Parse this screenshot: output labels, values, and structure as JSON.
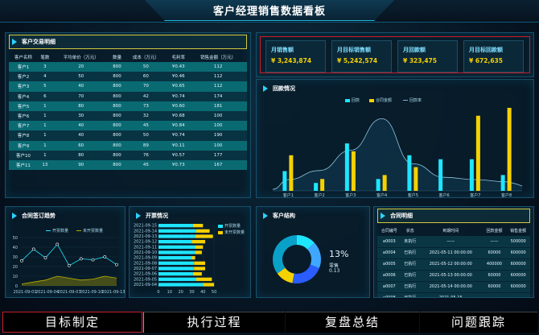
{
  "header": {
    "title": "客户经理销售数据看板"
  },
  "customer_table": {
    "title": "客户交易明细",
    "columns": [
      "客户名称",
      "笔数",
      "平均单价（万元）",
      "数量",
      "成本（万元）",
      "毛利率",
      "销售金额（万元）"
    ],
    "rows": [
      [
        "客户1",
        "3",
        "20",
        "800",
        "50",
        "¥0.43",
        "112"
      ],
      [
        "客户2",
        "4",
        "50",
        "800",
        "60",
        "¥0.46",
        "112"
      ],
      [
        "客户3",
        "5",
        "40",
        "800",
        "70",
        "¥0.65",
        "112"
      ],
      [
        "客户4",
        "6",
        "70",
        "800",
        "42",
        "¥0.74",
        "174"
      ],
      [
        "客户5",
        "1",
        "80",
        "800",
        "73",
        "¥0.60",
        "181"
      ],
      [
        "客户6",
        "1",
        "30",
        "800",
        "32",
        "¥0.68",
        "100"
      ],
      [
        "客户7",
        "1",
        "40",
        "800",
        "45",
        "¥0.84",
        "100"
      ],
      [
        "客户8",
        "1",
        "40",
        "800",
        "50",
        "¥0.74",
        "190"
      ],
      [
        "客户9",
        "1",
        "60",
        "800",
        "89",
        "¥0.11",
        "100"
      ],
      [
        "客户10",
        "1",
        "80",
        "800",
        "76",
        "¥0.57",
        "177"
      ],
      [
        "客户11",
        "13",
        "90",
        "800",
        "45",
        "¥0.73",
        "167"
      ]
    ]
  },
  "kpis": [
    {
      "label": "月销售额",
      "value": "¥ 3,243,874"
    },
    {
      "label": "月目标销售额",
      "value": "¥ 5,242,574"
    },
    {
      "label": "月回款额",
      "value": "¥ 323,475"
    },
    {
      "label": "月目标回款额",
      "value": "¥ 672,635"
    }
  ],
  "payment_panel": {
    "title": "回款情况"
  },
  "contract_panel": {
    "title": "合同签订趋势"
  },
  "invoice_panel": {
    "title": "开票情况"
  },
  "structure_panel": {
    "title": "客户结构",
    "percent": "13%",
    "sub_label": "零售",
    "sub_value": "0.13"
  },
  "contract_detail": {
    "title": "合同明细",
    "columns": [
      "合同编号",
      "状态",
      "到期时间",
      "回款金额",
      "销售金额"
    ],
    "rows": [
      [
        "a0003",
        "未执行",
        "——",
        "——",
        "500000"
      ],
      [
        "a0004",
        "已执行",
        "2021-05-11 00:00:00",
        "60000",
        "600000"
      ],
      [
        "a0005",
        "已执行",
        "2021-05-12 00:00:00",
        "400000",
        "600000"
      ],
      [
        "a0006",
        "已执行",
        "2021-05-13 00:00:00",
        "60000",
        "600000"
      ],
      [
        "a0007",
        "已执行",
        "2021-05-14 00:00:00",
        "60000",
        "600000"
      ],
      [
        "a0008",
        "已执行",
        "2021-05-15",
        "",
        ""
      ]
    ]
  },
  "bottom_tabs": [
    "目标制定",
    "执行过程",
    "复盘总结",
    "问题跟踪"
  ],
  "colors": {
    "accent": "#2bd3ff",
    "cyan": "#1ee6ff",
    "yellow": "#f5d100",
    "tab_active_border": "#d22"
  },
  "chart_data": [
    {
      "type": "bar",
      "title": "回款情况",
      "categories": [
        "客户1",
        "客户2",
        "客户3",
        "客户4",
        "客户5",
        "客户6",
        "客户7",
        "客户8"
      ],
      "series": [
        {
          "name": "回款",
          "values": [
            5,
            2,
            12,
            3,
            9,
            8,
            8,
            4
          ]
        },
        {
          "name": "合同金额",
          "values": [
            9,
            3,
            10,
            4,
            6,
            0,
            19,
            21
          ]
        },
        {
          "name": "回款率",
          "values": [
            0.5,
            0.9,
            1.8,
            3.2,
            1.2,
            0.6,
            0.5,
            0.4
          ]
        }
      ],
      "ylim": [
        0,
        22
      ]
    },
    {
      "type": "line",
      "title": "合同签订趋势",
      "x": [
        "2021-09-01",
        "2021-09-04",
        "2021-09-07",
        "2021-09-10",
        "2021-09-13"
      ],
      "series": [
        {
          "name": "开票数量",
          "values": [
            26,
            38,
            29,
            43,
            21,
            28,
            27,
            30,
            22
          ]
        },
        {
          "name": "未开票数量",
          "values": [
            2,
            4,
            6,
            10,
            8,
            6,
            7,
            10,
            8
          ]
        }
      ],
      "yticks": [
        "50",
        "40",
        "30",
        "20",
        "10",
        "0"
      ],
      "ylim": [
        0,
        50
      ]
    },
    {
      "type": "bar",
      "title": "开票情况",
      "categories": [
        "2021-09-15",
        "2021-09-14",
        "2021-09-13",
        "2021-09-12",
        "2021-09-11",
        "2021-09-10",
        "2021-09-09",
        "2021-09-08",
        "2021-09-07",
        "2021-09-06",
        "2021-09-05",
        "2021-09-04"
      ],
      "series": [
        {
          "name": "开票数量",
          "values": [
            31,
            34,
            33,
            30,
            33,
            33,
            30,
            32,
            32,
            31,
            34,
            40
          ]
        },
        {
          "name": "未开票数量",
          "values": [
            9,
            12,
            16,
            12,
            7,
            6,
            3,
            10,
            10,
            8,
            14,
            10
          ]
        }
      ],
      "xticks": [
        "0",
        "10",
        "20",
        "30",
        "40",
        "50"
      ],
      "xlim": [
        0,
        55
      ]
    },
    {
      "type": "pie",
      "title": "客户结构",
      "values": [
        0.13,
        0.18,
        0.22,
        0.12,
        0.35
      ],
      "colors": [
        "#1ee6ff",
        "#3fa7ff",
        "#2a5cff",
        "#f5d100",
        "#0aa1c9"
      ]
    }
  ]
}
